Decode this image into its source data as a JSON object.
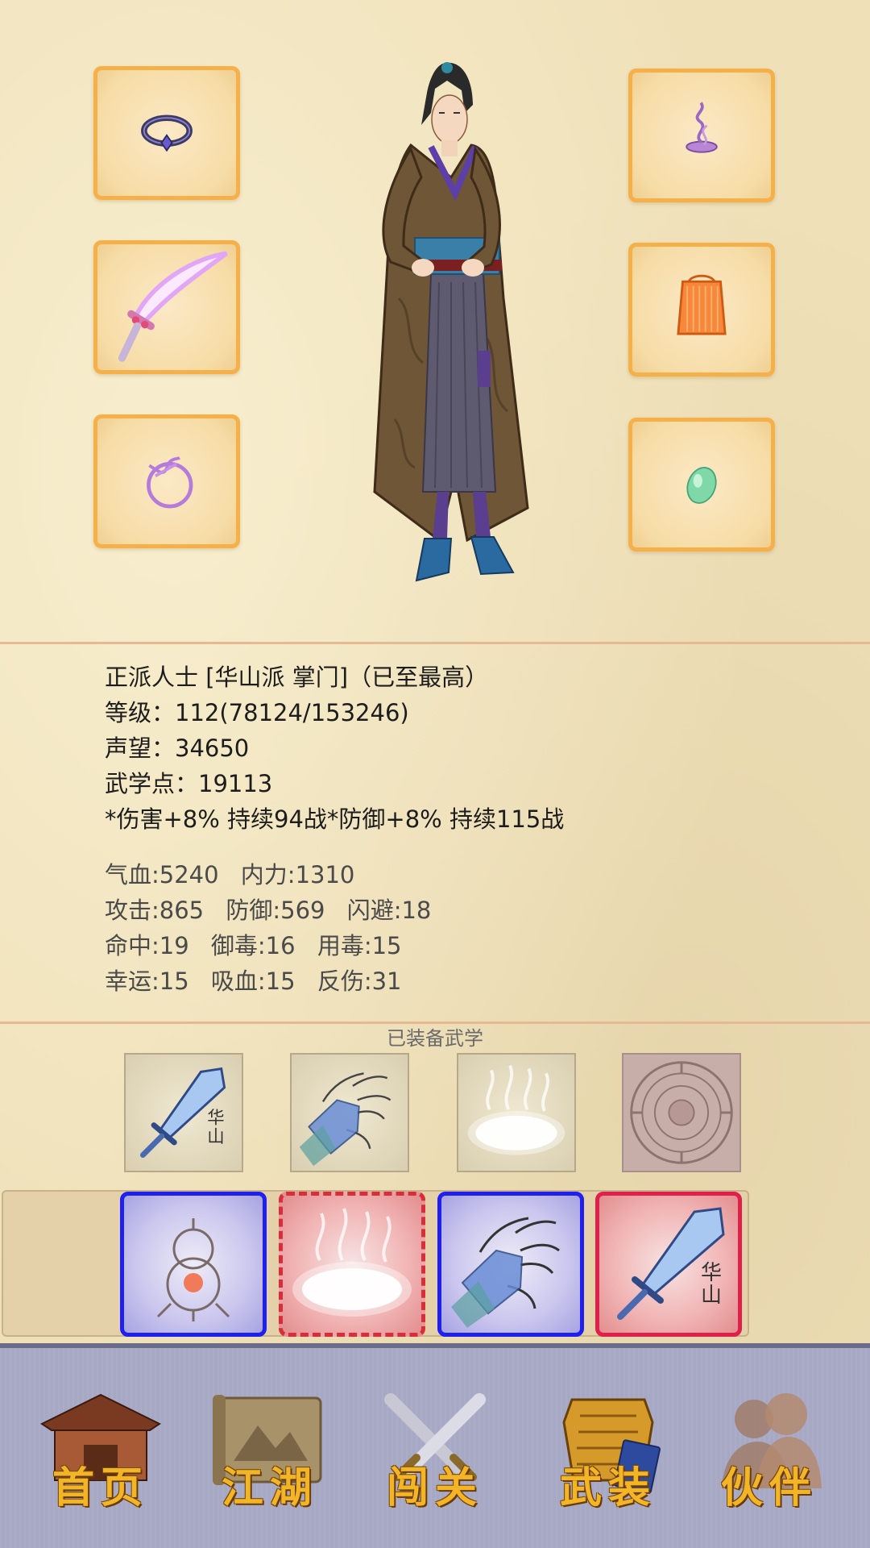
{
  "equipment": {
    "left": [
      "ring-icon",
      "saber-icon",
      "ribbon-ring-icon"
    ],
    "right": [
      "incense-icon",
      "armor-icon",
      "jade-icon"
    ]
  },
  "character": {
    "icon": "swordsman-figure"
  },
  "info": {
    "faction_line": "正派人士 [华山派 掌门]（已至最高）",
    "level_line": "等级：112(78124/153246)",
    "reputation_line": "声望：34650",
    "martial_points_line": "武学点：19113",
    "buff_line": "*伤害+8% 持续94战*防御+8% 持续115战"
  },
  "attributes": {
    "hp": "气血:5240",
    "mp": "内力:1310",
    "attack": "攻击:865",
    "defense": "防御:569",
    "dodge": "闪避:18",
    "hit": "命中:19",
    "poison_resist": "御毒:16",
    "poison_use": "用毒:15",
    "luck": "幸运:15",
    "lifesteal": "吸血:15",
    "reflect": "反伤:31"
  },
  "martial": {
    "title": "已装备武学",
    "equipped": [
      {
        "icon": "huashan-sword-icon",
        "tag": "华山"
      },
      {
        "icon": "palm-icon"
      },
      {
        "icon": "qi-cloud-icon"
      },
      {
        "icon": "seal-disc-icon"
      }
    ],
    "cards": [
      {
        "icon": "gourd-icon",
        "color": "blue"
      },
      {
        "icon": "qi-cloud-icon",
        "color": "red"
      },
      {
        "icon": "palm-icon",
        "color": "blue"
      },
      {
        "icon": "huashan-sword-icon",
        "color": "red",
        "tag": "华山"
      }
    ]
  },
  "nav": {
    "home": "首页",
    "jianghu": "江湖",
    "chuangguan": "闯关",
    "wuzhuang": "武装",
    "huoban": "伙伴"
  },
  "colors": {
    "slot_border": "#f6b04a",
    "card_blue": "#1f1ff0",
    "card_red": "#e0204a",
    "nav_label": "#f2b526"
  }
}
